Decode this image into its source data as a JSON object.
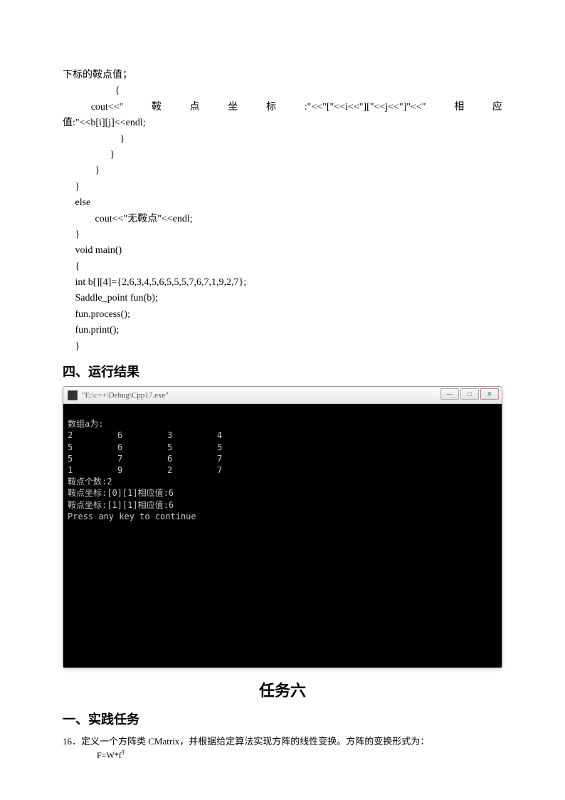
{
  "code": {
    "line1": "下标的鞍点值；",
    "brace_open": "{",
    "cout_parts": [
      "cout<<\"",
      "鞍",
      "点",
      "坐",
      "标",
      ":\"<<\"[\"<<i<<\"][\"<<j<<\"]\"<<\"",
      "相",
      "应"
    ],
    "line_val": "值:\"<<b[i][j]<<endl;",
    "brace_close1": "}",
    "brace_close2": "}",
    "brace_close3": "}",
    "brace_close4": "}",
    "else": "else",
    "cout_none": "cout<<\"无鞍点\"<<endl;",
    "brace_close5": "}",
    "voidmain": "void main()",
    "brace_open2": "{",
    "arr": "int b[][4]={2,6,3,4,5,6,5,5,5,7,6,7,1,9,2,7};",
    "funb": "Saddle_point fun(b);",
    "proc": "fun.process();",
    "print": "fun.print();",
    "brace_close6": "}"
  },
  "sections": {
    "results_heading": "四、运行结果",
    "task_title": "任务六",
    "practice_heading": "一、实践任务",
    "task16": "16．定义一个方阵类 CMatrix，并根据给定算法实现方阵的线性变换。方阵的变换形式为：",
    "formula": "F=W*f"
  },
  "console": {
    "title": "\"E:\\c++\\Debug\\Cpp17.exe\"",
    "header": "数组a为:",
    "rows": [
      [
        "2",
        "6",
        "3",
        "4"
      ],
      [
        "5",
        "6",
        "5",
        "5"
      ],
      [
        "5",
        "7",
        "6",
        "7"
      ],
      [
        "1",
        "9",
        "2",
        "7"
      ]
    ],
    "count": "鞍点个数:2",
    "s1": "鞍点坐标:[0][1]相应值:6",
    "s2": "鞍点坐标:[1][1]相应值:6",
    "press": "Press any key to continue"
  },
  "winbtn": {
    "min": "—",
    "max": "□",
    "close": "✕"
  }
}
